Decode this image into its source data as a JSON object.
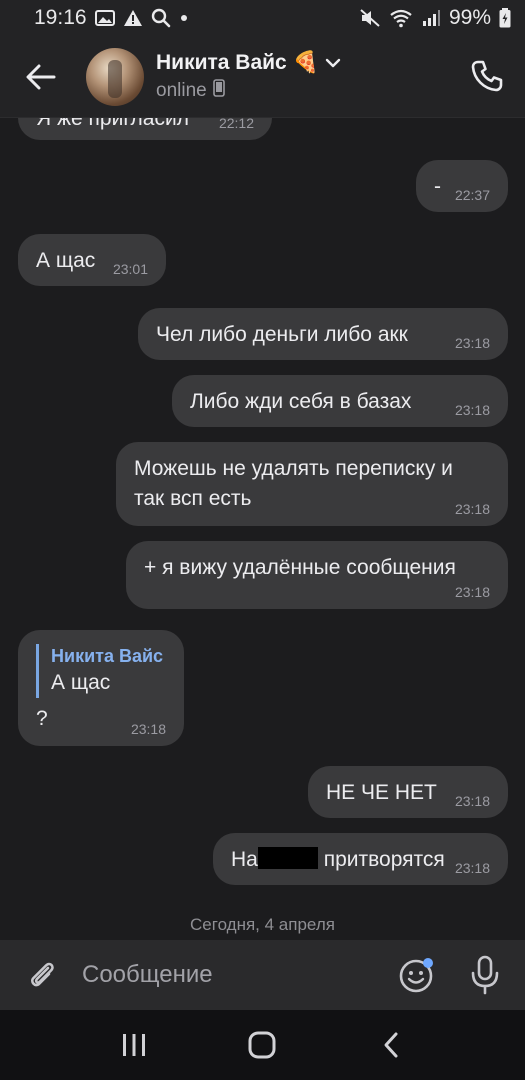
{
  "status_bar": {
    "time": "19:16",
    "battery": "99%",
    "icons": [
      "gallery-icon",
      "warning-icon",
      "search-icon",
      "dot-icon",
      "mute-icon",
      "wifi-icon",
      "signal-icon",
      "battery-icon"
    ]
  },
  "header": {
    "name": "Никита Вайс",
    "emoji": "🍕",
    "status": "online",
    "icons": [
      "back-arrow-icon",
      "chevron-down-icon",
      "phone-small-icon",
      "call-icon"
    ]
  },
  "messages": [
    {
      "id": "m0",
      "side": "left",
      "text": "Я же пригласил",
      "time": "22:12",
      "partial": true
    },
    {
      "id": "m1",
      "side": "right",
      "text": "-",
      "time": "22:37"
    },
    {
      "id": "m2",
      "side": "left",
      "text": "А щас",
      "time": "23:01"
    },
    {
      "id": "m3",
      "side": "right",
      "text": "Чел либо деньги либо акк",
      "time": "23:18"
    },
    {
      "id": "m4",
      "side": "right",
      "text": "Либо жди себя в базах",
      "time": "23:18"
    },
    {
      "id": "m5",
      "side": "right",
      "line1": "Можешь не удалять переписку и",
      "line2": "так всп есть",
      "time": "23:18"
    },
    {
      "id": "m6",
      "side": "right",
      "text": "+ я вижу удалённые сообщения",
      "time": "23:18"
    },
    {
      "id": "m7",
      "side": "left",
      "reply_author": "Никита Вайс",
      "reply_text": "А щас",
      "text": "?",
      "time": "23:18"
    },
    {
      "id": "m8",
      "side": "right",
      "text": "НЕ ЧЕ НЕТ",
      "time": "23:18"
    },
    {
      "id": "m9",
      "side": "right",
      "prefix": "На",
      "suffix": " притворятся",
      "time": "23:18",
      "redacted": true
    }
  ],
  "date_separator": "Сегодня, 4 апреля",
  "input": {
    "placeholder": "Сообщение",
    "icons": [
      "attach-icon",
      "emoji-icon",
      "mic-icon"
    ]
  },
  "nav": {
    "icons": [
      "recent-apps-icon",
      "home-icon",
      "back-icon"
    ]
  },
  "colors": {
    "background": "#1c1c1e",
    "bubble": "#3a3a3c",
    "reply_accent": "#7aa7e3"
  }
}
